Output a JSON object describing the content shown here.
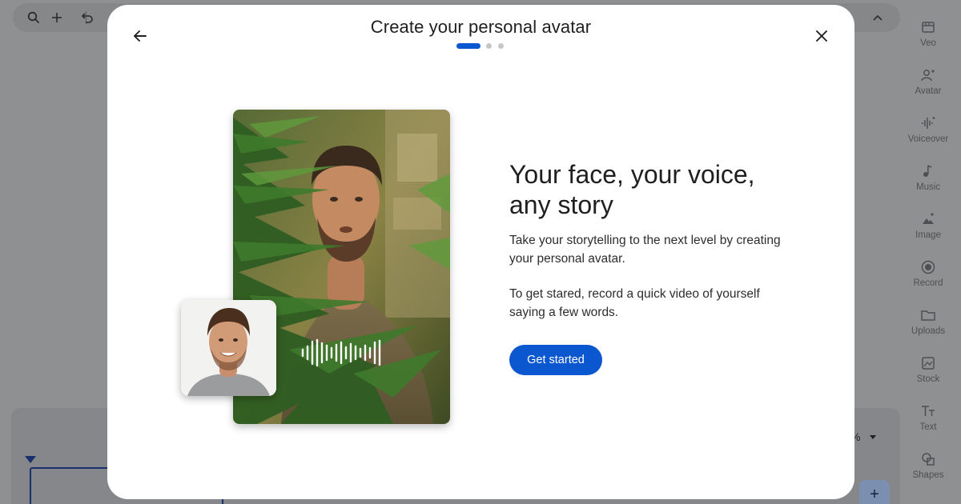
{
  "toolbar": {
    "search_icon": "search-icon",
    "add_icon": "plus-icon",
    "undo_icon": "undo-icon",
    "collapse_icon": "chevron-up-icon"
  },
  "right_rail": {
    "items": [
      {
        "label": "Veo",
        "icon": "veo-icon"
      },
      {
        "label": "Avatar",
        "icon": "avatar-icon"
      },
      {
        "label": "Voiceover",
        "icon": "voiceover-icon"
      },
      {
        "label": "Music",
        "icon": "music-icon"
      },
      {
        "label": "Image",
        "icon": "image-icon"
      },
      {
        "label": "Record",
        "icon": "record-icon"
      },
      {
        "label": "Uploads",
        "icon": "folder-icon"
      },
      {
        "label": "Stock",
        "icon": "stock-icon"
      },
      {
        "label": "Text",
        "icon": "text-icon"
      },
      {
        "label": "Shapes",
        "icon": "shapes-icon"
      }
    ]
  },
  "timeline": {
    "zoom_text": "%",
    "add_icon": "plus-icon"
  },
  "modal": {
    "title": "Create your personal avatar",
    "steps": {
      "total": 3,
      "current": 1
    },
    "headline": "Your face, your voice, any story",
    "paragraph1": "Take your storytelling to the next level by creating your personal avatar.",
    "paragraph2": "To get stared, record a quick video of yourself saying a few words.",
    "cta_label": "Get started",
    "back_icon": "arrow-left-icon",
    "close_icon": "close-icon"
  },
  "colors": {
    "accent": "#0b57d0",
    "step_inactive": "#c4c7c5",
    "overlay_bg": "#8f9092",
    "modal_bg": "#ffffff"
  }
}
